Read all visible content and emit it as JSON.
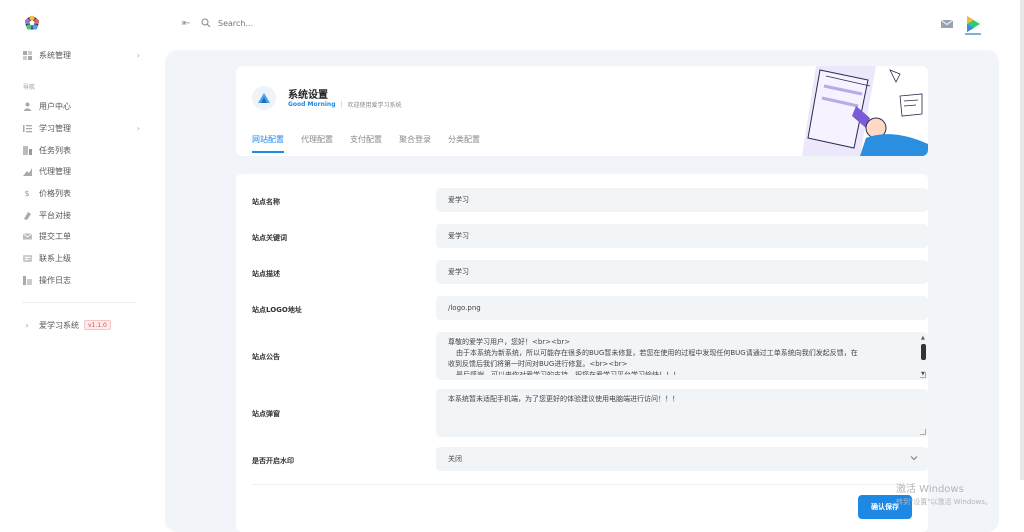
{
  "sidebar": {
    "items_top": [
      {
        "label": "系统管理",
        "icon": "grid-icon"
      }
    ],
    "group_label": "导航",
    "items": [
      {
        "label": "用户中心",
        "icon": "user-icon"
      },
      {
        "label": "学习管理",
        "icon": "list-icon"
      },
      {
        "label": "任务列表",
        "icon": "tasks-icon"
      },
      {
        "label": "代理管理",
        "icon": "agent-icon"
      },
      {
        "label": "价格列表",
        "icon": "dollar-icon"
      },
      {
        "label": "平台对接",
        "icon": "link-icon"
      },
      {
        "label": "提交工单",
        "icon": "ticket-icon"
      },
      {
        "label": "联系上级",
        "icon": "contact-icon"
      },
      {
        "label": "操作日志",
        "icon": "log-icon"
      }
    ],
    "footer": {
      "label": "爱学习系统",
      "version": "v1.1.0"
    }
  },
  "topbar": {
    "search_placeholder": "Search..."
  },
  "header": {
    "title": "系统设置",
    "greeting": "Good Morning",
    "subtitle": "欢迎使用爱学习系统",
    "tabs": [
      "网站配置",
      "代理配置",
      "支付配置",
      "聚合登录",
      "分类配置"
    ],
    "active_tab": 0
  },
  "form": {
    "site_name": {
      "label": "站点名称",
      "value": "爱学习"
    },
    "keywords": {
      "label": "站点关键词",
      "value": "爱学习"
    },
    "description": {
      "label": "站点描述",
      "value": "爱学习"
    },
    "logo": {
      "label": "站点LOGO地址",
      "value": "/logo.png"
    },
    "notice": {
      "label": "站点公告",
      "line1": "尊敬的爱学习用户，您好！<br><br>",
      "line2": "由于本系统为新系统，所以可能存在很多的BUG暂未修复，若您在使用的过程中发现任何BUG请通过工单系统向我们发起反馈，在",
      "line3": "收到反馈后我们将第一时间对BUG进行修复。<br><br>",
      "line4": "最后感谢，可以来你对爱学习的支持，祝您在爱学习平台学习愉快！！！"
    },
    "popup": {
      "label": "站点弹窗",
      "value": "本系统暂未适配手机端，为了您更好的体验建议使用电脑端进行访问！！！"
    },
    "watermark": {
      "label": "是否开启水印",
      "value": "关闭"
    },
    "save_label": "确认保存"
  },
  "os_watermark": {
    "line1": "激活 Windows",
    "line2": "转到\"设置\"以激活 Windows。"
  },
  "colors": {
    "accent": "#1e88e5",
    "background": "#f1f4f8"
  }
}
